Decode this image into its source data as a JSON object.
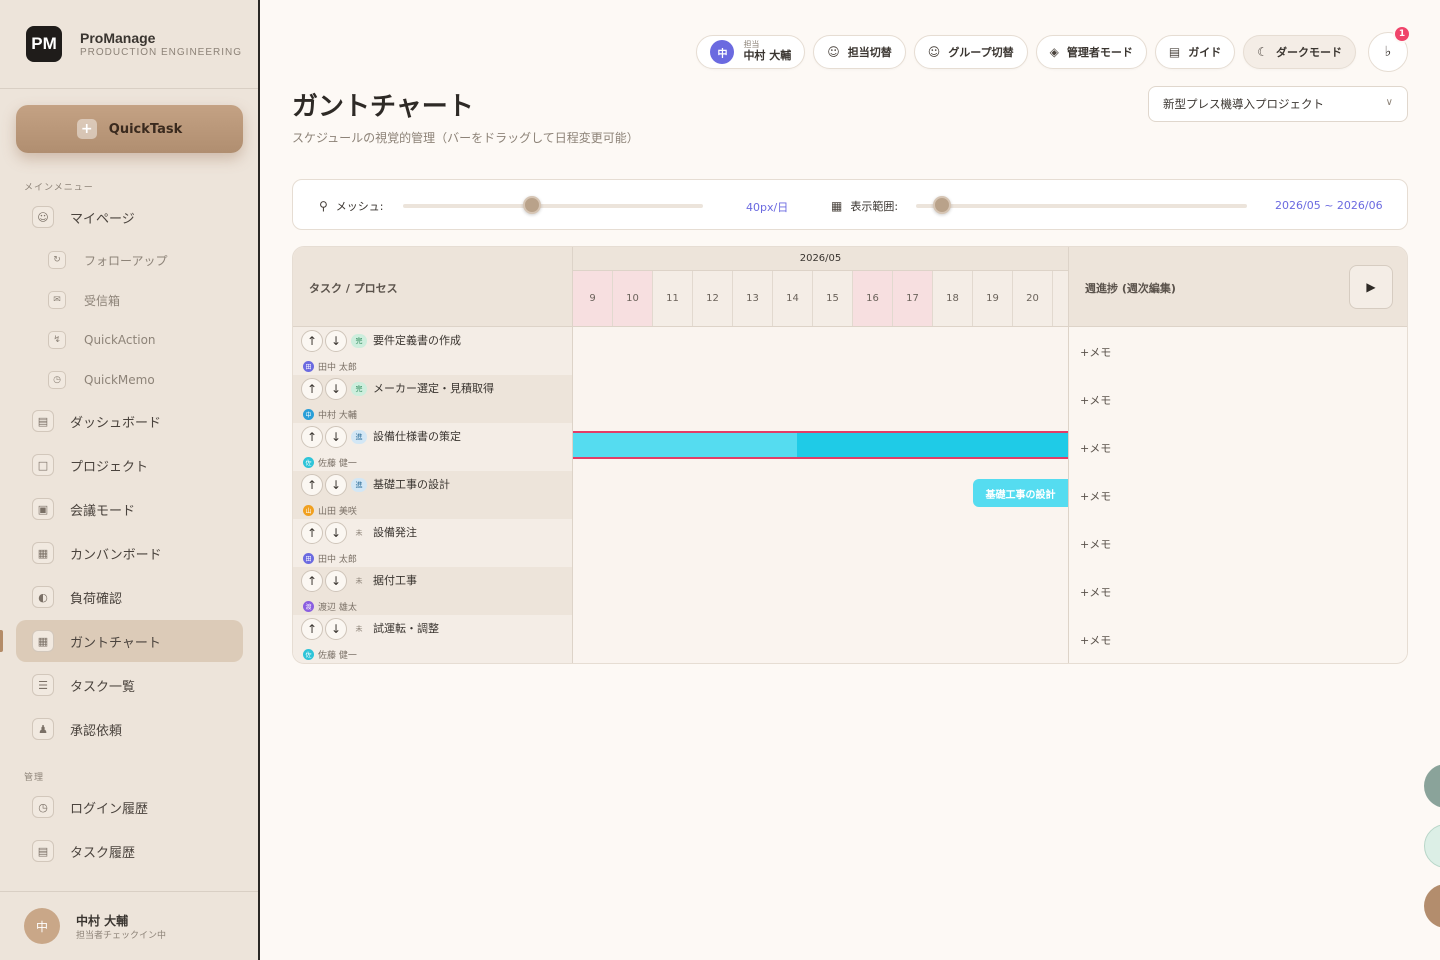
{
  "brand": {
    "logo": "PM",
    "name": "ProManage",
    "subtitle": "PRODUCTION ENGINEERING"
  },
  "sidebar": {
    "quicktask": {
      "icon": "+",
      "label": "QuickTask"
    },
    "main_section": "メインメニュー",
    "items": [
      {
        "label": "マイページ",
        "icon": "user-icon"
      },
      {
        "label": "フォローアップ",
        "icon": "followup-icon"
      },
      {
        "label": "受信箱",
        "icon": "inbox-icon"
      },
      {
        "label": "QuickAction",
        "icon": "bolt-icon"
      },
      {
        "label": "QuickMemo",
        "icon": "clock-icon"
      },
      {
        "label": "ダッシュボード",
        "icon": "chart-icon"
      },
      {
        "label": "プロジェクト",
        "icon": "folder-icon"
      },
      {
        "label": "会議モード",
        "icon": "presentation-icon"
      },
      {
        "label": "カンバンボード",
        "icon": "kanban-icon"
      },
      {
        "label": "負荷確認",
        "icon": "gauge-icon"
      },
      {
        "label": "ガントチャート",
        "icon": "calendar-icon",
        "active": true
      },
      {
        "label": "タスク一覧",
        "icon": "list-icon"
      },
      {
        "label": "承認依頼",
        "icon": "stamp-icon"
      }
    ],
    "admin_section": "管理",
    "admin_items": [
      {
        "label": "ログイン履歴",
        "icon": "clock-icon"
      },
      {
        "label": "タスク履歴",
        "icon": "document-icon"
      }
    ],
    "user": {
      "avatar": "中",
      "name": "中村 大輔",
      "status": "担当者チェックイン中"
    }
  },
  "topbar": {
    "assignee": {
      "avatar": "中",
      "label": "担当",
      "name": "中村 大輔"
    },
    "buttons": [
      {
        "label": "担当切替",
        "icon": "user-switch-icon"
      },
      {
        "label": "グループ切替",
        "icon": "group-switch-icon"
      },
      {
        "label": "管理者モード",
        "icon": "lock-icon"
      },
      {
        "label": "ガイド",
        "icon": "book-icon"
      },
      {
        "label": "ダークモード",
        "icon": "moon-icon"
      }
    ],
    "notifications": 1
  },
  "page": {
    "title": "ガントチャート",
    "subtitle": "スケジュールの視覚的管理（バーをドラッグして日程変更可能）",
    "project": "新型プレス機導入プロジェクト"
  },
  "controls": {
    "mesh_label": "メッシュ:",
    "mesh_value": "40px/日",
    "mesh_level": 0.43,
    "range_label": "表示範囲:",
    "range_value": "2026/05 ~ 2026/06",
    "range_level": 0.08
  },
  "gantt": {
    "task_header": "タスク / プロセス",
    "month": "2026/05",
    "days": [
      {
        "d": "9",
        "weekend": true
      },
      {
        "d": "10",
        "weekend": true
      },
      {
        "d": "11",
        "weekend": false
      },
      {
        "d": "12",
        "weekend": false
      },
      {
        "d": "13",
        "weekend": false
      },
      {
        "d": "14",
        "weekend": false
      },
      {
        "d": "15",
        "weekend": false
      },
      {
        "d": "16",
        "weekend": true
      },
      {
        "d": "17",
        "weekend": true
      },
      {
        "d": "18",
        "weekend": false
      },
      {
        "d": "19",
        "weekend": false
      },
      {
        "d": "20",
        "weekend": false
      }
    ],
    "progress_header": "週進捗 (週次編集)",
    "memo_label": "+メモ",
    "tasks": [
      {
        "name": "要件定義書の作成",
        "status": "完",
        "status_type": "done",
        "owner": "田中 太郎",
        "owner_initial": "田",
        "owner_color": "#6b6ae0"
      },
      {
        "name": "メーカー選定・見積取得",
        "status": "完",
        "status_type": "done",
        "owner": "中村 大輔",
        "owner_initial": "中",
        "owner_color": "#2a9fd8"
      },
      {
        "name": "設備仕様書の策定",
        "status": "進",
        "status_type": "prog",
        "owner": "佐藤 健一",
        "owner_initial": "佐",
        "owner_color": "#2ec4d8"
      },
      {
        "name": "基礎工事の設計",
        "status": "進",
        "status_type": "prog",
        "owner": "山田 美咲",
        "owner_initial": "山",
        "owner_color": "#f0a020",
        "bar_label": "基礎工事の設計"
      },
      {
        "name": "設備発注",
        "status": "未",
        "status_type": "none",
        "owner": "田中 太郎",
        "owner_initial": "田",
        "owner_color": "#6b6ae0"
      },
      {
        "name": "据付工事",
        "status": "未",
        "status_type": "none",
        "owner": "渡辺 雄太",
        "owner_initial": "渡",
        "owner_color": "#8a5ee0"
      },
      {
        "name": "試運転・調整",
        "status": "未",
        "status_type": "none",
        "owner": "佐藤 健一",
        "owner_initial": "佐",
        "owner_color": "#2ec4d8"
      }
    ]
  }
}
